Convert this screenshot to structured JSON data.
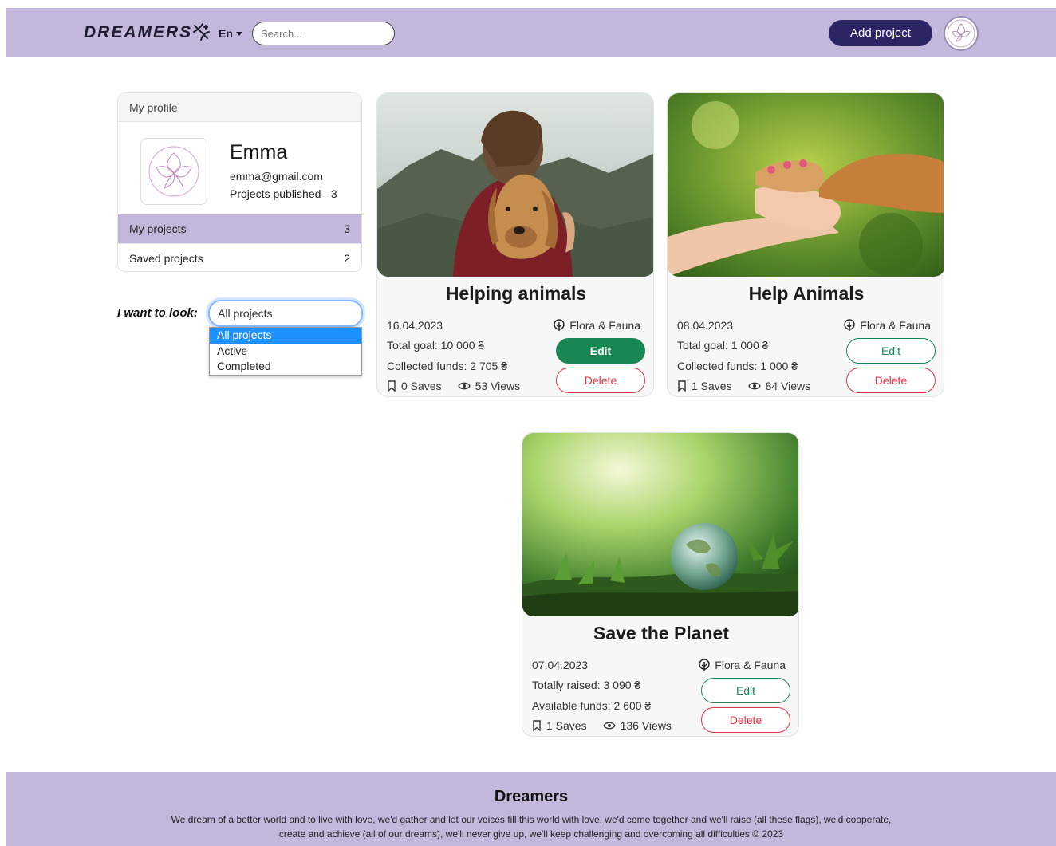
{
  "header": {
    "logo": "DREAMERS",
    "lang": "En",
    "search_placeholder": "Search...",
    "add_project": "Add project"
  },
  "profile": {
    "heading": "My profile",
    "name": "Emma",
    "email": "emma@gmail.com",
    "published": "Projects published - 3",
    "nav": [
      {
        "label": "My projects",
        "count": "3"
      },
      {
        "label": "Saved projects",
        "count": "2"
      }
    ]
  },
  "filter": {
    "label": "I want to look:",
    "selected": "All projects",
    "options": [
      "All projects",
      "Active",
      "Completed"
    ]
  },
  "projects": [
    {
      "title": "Helping animals",
      "date": "16.04.2023",
      "category": "Flora & Fauna",
      "line1": "Total goal: 10 000 ₴",
      "line2": "Collected funds: 2 705 ₴",
      "saves": "0 Saves",
      "views": "53 Views",
      "edit": "Edit",
      "delete": "Delete"
    },
    {
      "title": "Help Animals",
      "date": "08.04.2023",
      "category": "Flora & Fauna",
      "line1": "Total goal: 1 000 ₴",
      "line2": "Collected funds: 1 000 ₴",
      "saves": "1 Saves",
      "views": "84 Views",
      "edit": "Edit",
      "delete": "Delete"
    },
    {
      "title": "Save the Planet",
      "date": "07.04.2023",
      "category": "Flora & Fauna",
      "line1": "Totally raised: 3 090 ₴",
      "line2": "Available funds: 2 600 ₴",
      "saves": "1 Saves",
      "views": "136 Views",
      "edit": "Edit",
      "delete": "Delete"
    }
  ],
  "footer": {
    "title": "Dreamers",
    "text": "We dream of a better world and to live with love, we'd gather and let our voices fill this world with love, we'd come together and we'll raise (all these flags), we'd cooperate, create and achieve (all of our dreams), we'll never give up, we'll keep challenging and overcoming all difficulties © 2023"
  },
  "colors": {
    "brand_lavender": "#c3b8dc",
    "navy": "#2b2663",
    "success": "#198754",
    "danger": "#dc3545"
  }
}
